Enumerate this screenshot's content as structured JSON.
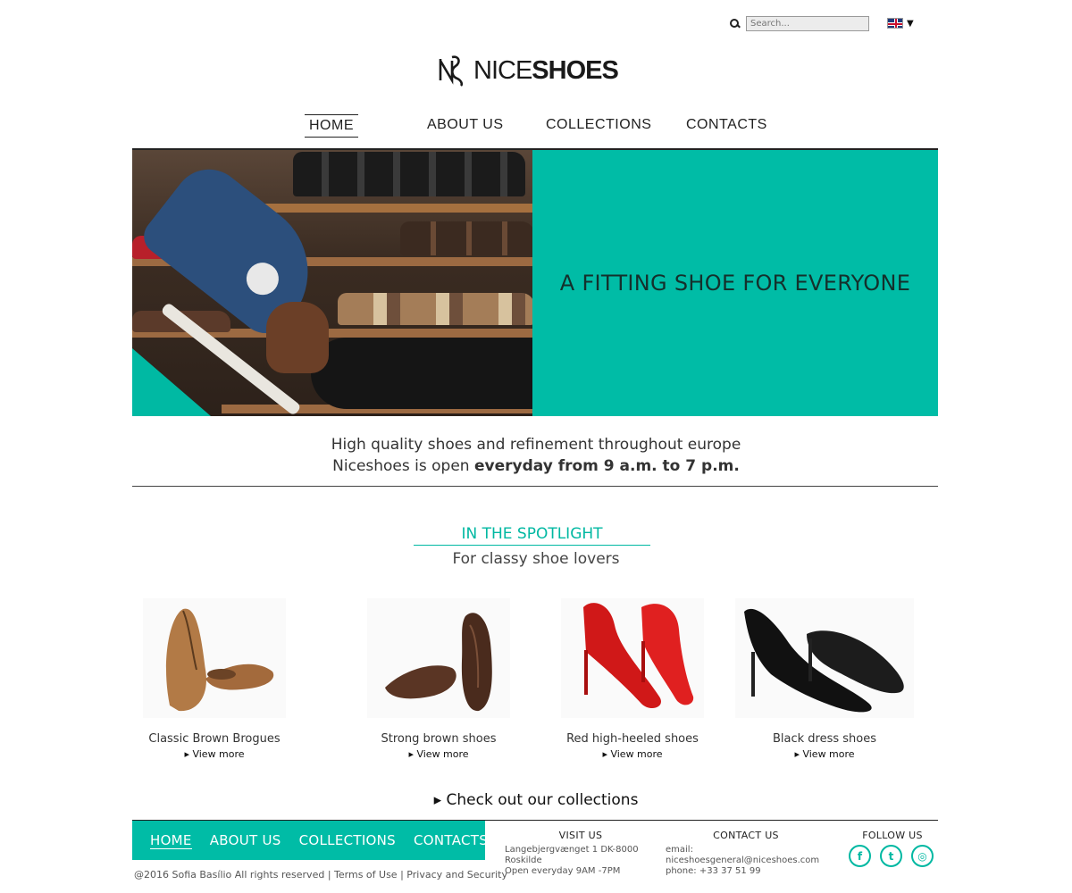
{
  "header": {
    "search_placeholder": "Search...",
    "language": "EN",
    "logo_light": "NICE",
    "logo_bold": "SHOES"
  },
  "nav": {
    "items": [
      "HOME",
      "ABOUT US",
      "COLLECTIONS",
      "CONTACTS"
    ],
    "active": "HOME"
  },
  "hero": {
    "title": "A FITTING SHOE FOR EVERYONE",
    "accent_color": "#00bca6"
  },
  "intro": {
    "line1": "High quality shoes and refinement throughout europe",
    "line2_prefix": "Niceshoes is open ",
    "line2_bold": "everyday from 9 a.m. to 7 p.m."
  },
  "spotlight": {
    "title": "IN THE SPOTLIGHT",
    "subtitle": "For classy shoe lovers",
    "view_more": "▸ View more",
    "products": [
      {
        "name": "Classic Brown Brogues"
      },
      {
        "name": "Strong brown shoes"
      },
      {
        "name": "Red high-heeled shoes"
      },
      {
        "name": "Black dress shoes"
      }
    ]
  },
  "collections_link": "▸ Check out our collections",
  "footer": {
    "nav": [
      "HOME",
      "ABOUT US",
      "COLLECTIONS",
      "CONTACTS"
    ],
    "copyright": "@2016 Sofia Basílio All rights reserved |",
    "terms": "Terms of Use",
    "separator": "|",
    "privacy": "Privacy and Security",
    "visit": {
      "head": "VISIT US",
      "address": "Langebjergvænget 1 DK-8000 Roskilde",
      "hours": "Open everyday 9AM -7PM"
    },
    "contact": {
      "head": "CONTACT US",
      "email": "email: niceshoesgeneral@niceshoes.com",
      "phone": "phone: +33 37 51 99"
    },
    "follow": {
      "head": "FOLLOW US",
      "icons": [
        "facebook-icon",
        "twitter-icon",
        "instagram-icon"
      ]
    }
  }
}
